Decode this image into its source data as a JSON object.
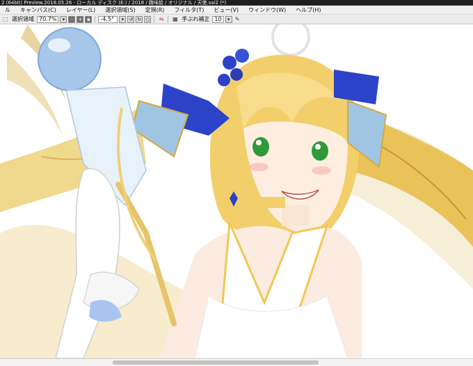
{
  "window": {
    "title": "2 (64bit) Preview.2018.05.26 - ローカル ディスク (E:) / 2018 / 趣味絵 / オリジナル / 天使.sai2 (*)"
  },
  "menubar": {
    "items": [
      {
        "label": "ル"
      },
      {
        "label": "キャンバス(C)"
      },
      {
        "label": "レイヤー(L)"
      },
      {
        "label": "選択領域(S)"
      },
      {
        "label": "定規(R)"
      },
      {
        "label": "フィルタ(T)"
      },
      {
        "label": "ビュー(V)"
      },
      {
        "label": "ウィンドウ(W)"
      },
      {
        "label": "ヘルプ(H)"
      }
    ]
  },
  "toolbar": {
    "selection_label": "選択領域",
    "zoom_value": "70.7%",
    "zoom_minus": "-",
    "zoom_plus": "+",
    "rotation_value": "-4.5°",
    "stabilizer_label": "手ぶれ補正",
    "stabilizer_value": "10",
    "dropdown_symbol": "▾"
  },
  "icons": {
    "selection": "selection-icon",
    "zoom-reset": "zoom-reset-icon",
    "rotate-left": "rotate-left-icon",
    "rotate-right": "rotate-right-icon",
    "flip": "flip-icon",
    "pen": "pen-icon"
  },
  "colors": {
    "titlebar": "#1f1f1f",
    "menubar": "#f0f0f0",
    "toolbar": "#ececec",
    "hair": "#e9c56a",
    "ribbon": "#2c43c9",
    "eyes": "#2f9a3a"
  }
}
